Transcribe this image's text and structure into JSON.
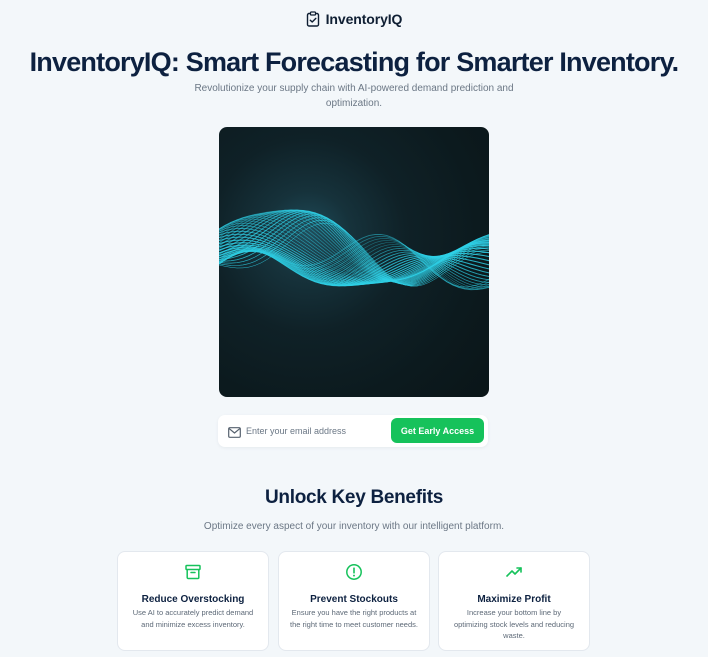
{
  "brand": {
    "name": "InventoryIQ",
    "icon": "clipboard-check-icon"
  },
  "hero": {
    "title": "InventoryIQ: Smart Forecasting for Smarter Inventory.",
    "subtitle": "Revolutionize your supply chain with AI-powered demand prediction and optimization.",
    "image_icon": "data-wave-visual"
  },
  "signup": {
    "email_placeholder": "Enter your email address",
    "email_value": "",
    "mail_icon": "mail-icon",
    "cta_label": "Get Early Access"
  },
  "benefits": {
    "title": "Unlock Key Benefits",
    "subtitle": "Optimize every aspect of your inventory with our intelligent platform.",
    "cards": [
      {
        "icon": "archive-box-icon",
        "title": "Reduce Overstocking",
        "description": "Use AI to accurately predict demand and minimize excess inventory."
      },
      {
        "icon": "alert-circle-icon",
        "title": "Prevent Stockouts",
        "description": "Ensure you have the right products at the right time to meet customer needs."
      },
      {
        "icon": "trending-up-icon",
        "title": "Maximize Profit",
        "description": "Increase your bottom line by optimizing stock levels and reducing waste."
      }
    ]
  },
  "colors": {
    "accent": "#16c25b",
    "heading": "#0d2140",
    "muted": "#6b7785",
    "background": "#f3f7fa",
    "wave": "#2fd0e6"
  }
}
